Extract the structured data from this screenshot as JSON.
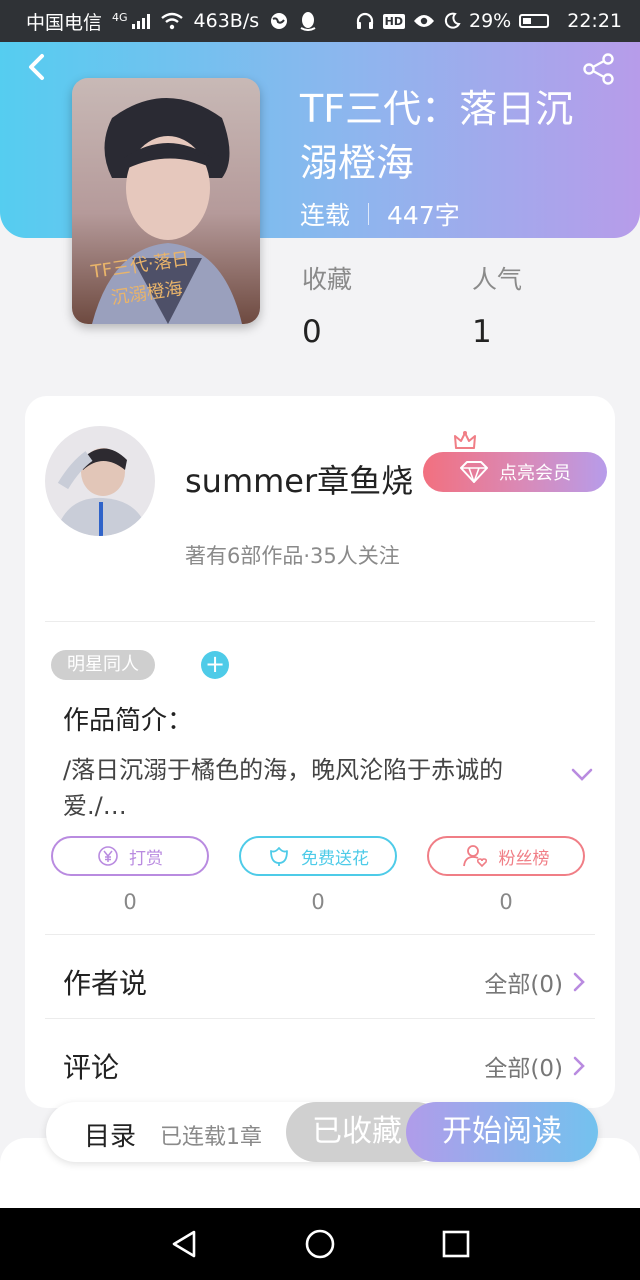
{
  "status_bar": {
    "carrier": "中国电信",
    "network": "4G",
    "speed": "463B/s",
    "battery": "29%",
    "time": "22:21"
  },
  "book": {
    "title": "TF三代：落日沉溺橙海",
    "status": "连载",
    "word_count": "447字",
    "favorites_label": "收藏",
    "favorites_value": "0",
    "popularity_label": "人气",
    "popularity_value": "1"
  },
  "author": {
    "name": "summer章鱼烧",
    "vip_label": "点亮会员",
    "stats": "著有6部作品·35人关注"
  },
  "tag": "明星同人",
  "intro": {
    "label": "作品简介：",
    "text": "/落日沉溺于橘色的海，晚风沦陷于赤诚的爱./…"
  },
  "actions": [
    {
      "label": "打赏",
      "count": "0",
      "color": "#b98be0"
    },
    {
      "label": "免费送花",
      "count": "0",
      "color": "#4ecbe8"
    },
    {
      "label": "粉丝榜",
      "count": "0",
      "color": "#f07e86"
    }
  ],
  "sections": {
    "author_says": {
      "title": "作者说",
      "all": "全部(0)"
    },
    "comments": {
      "title": "评论",
      "all": "全部(0)"
    }
  },
  "bottom": {
    "toc": "目录",
    "toc_sub": "已连载1章",
    "favorited": "已收藏",
    "start_reading": "开始阅读"
  },
  "colors": {
    "header_start": "#55cdf0",
    "header_end": "#b79cea",
    "accent_cyan": "#4ecbe8",
    "accent_purple": "#b98be0",
    "accent_red": "#f07e86"
  }
}
